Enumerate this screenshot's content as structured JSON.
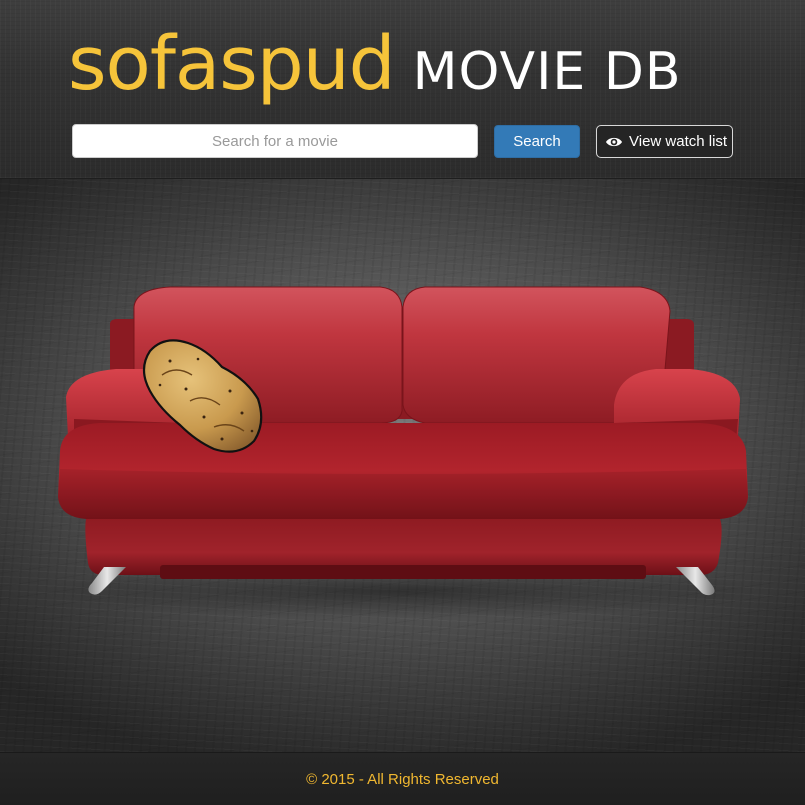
{
  "header": {
    "brand_primary": "sofaspud",
    "brand_secondary": "MOVIE DB",
    "search": {
      "placeholder": "Search for a movie",
      "value": ""
    },
    "search_button_label": "Search",
    "watchlist_button_label": "View watch list",
    "watchlist_icon": "eye-icon"
  },
  "hero": {
    "illustration": "red-sofa-with-potato"
  },
  "footer": {
    "copyright": "© 2015 - All Rights Reserved"
  },
  "colors": {
    "brand_yellow": "#f6c43a",
    "button_blue": "#337ab7",
    "footer_text": "#f0b730",
    "sofa_red": "#a5202a"
  }
}
